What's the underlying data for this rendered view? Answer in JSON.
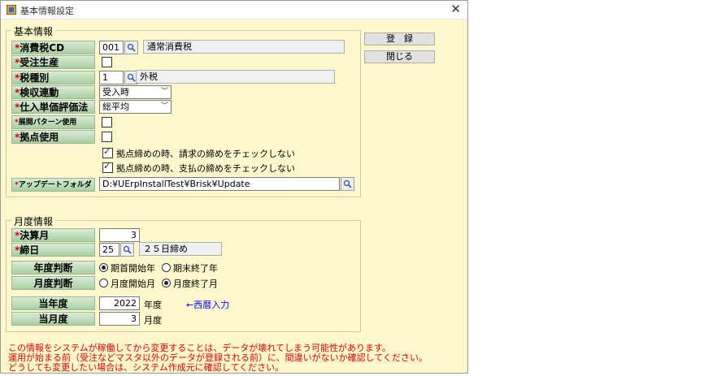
{
  "window": {
    "title": "基本情報設定",
    "close_symbol": "✕"
  },
  "buttons": {
    "register": "登　録",
    "close": "閉じる"
  },
  "basic": {
    "group_title": "基本情報",
    "tax_code": {
      "label": "消費税CD",
      "value": "001",
      "name": "通常消費税"
    },
    "order_production": {
      "label": "受注生産",
      "checked": false
    },
    "tax_type": {
      "label": "税種別",
      "value": "1",
      "name": "外税"
    },
    "inspection": {
      "label": "検収連動",
      "value": "受入時"
    },
    "valuation": {
      "label": "仕入単価評価法",
      "value": "総平均"
    },
    "pattern": {
      "label": "展開パターン使用",
      "checked": false
    },
    "branch": {
      "label": "拠点使用",
      "checked": false
    },
    "opt_billing": {
      "label": "拠点締めの時、請求の締めをチェックしない",
      "checked": true
    },
    "opt_payment": {
      "label": "拠点締めの時、支払の締めをチェックしない",
      "checked": true
    },
    "update_folder": {
      "label": "アップデートフォルダ",
      "value": "D:¥UErpInstallTest¥Brisk¥Update"
    }
  },
  "monthly": {
    "group_title": "月度情報",
    "settle_month": {
      "label": "決算月",
      "value": "3"
    },
    "closing_day": {
      "label": "締日",
      "value": "25",
      "name": "２５日締め"
    },
    "year_judge": {
      "label": "年度判断",
      "opt1": "期首開始年",
      "opt2": "期末終了年",
      "selected": "期首開始年"
    },
    "month_judge": {
      "label": "月度判断",
      "opt1": "月度開始月",
      "opt2": "月度終了月",
      "selected": "月度終了月"
    },
    "current_year": {
      "label": "当年度",
      "value": "2022",
      "unit": "年度",
      "hint": "←西暦入力"
    },
    "current_month": {
      "label": "当月度",
      "value": "3",
      "unit": "月度"
    }
  },
  "required_mark": "*",
  "warning": [
    "この情報をシステムが稼働してから変更することは、データが壊れてしまう可能性があります。",
    "運用が始まる前（受注などマスタ以外のデータが登録される前）に、間違いがないか確認してください。",
    "どうしても変更したい場合は、システム作成元に確認してください。"
  ],
  "icons": {
    "app": "app-form-icon",
    "search": "magnifier-icon",
    "dropdown": "chevron-down-icon"
  }
}
